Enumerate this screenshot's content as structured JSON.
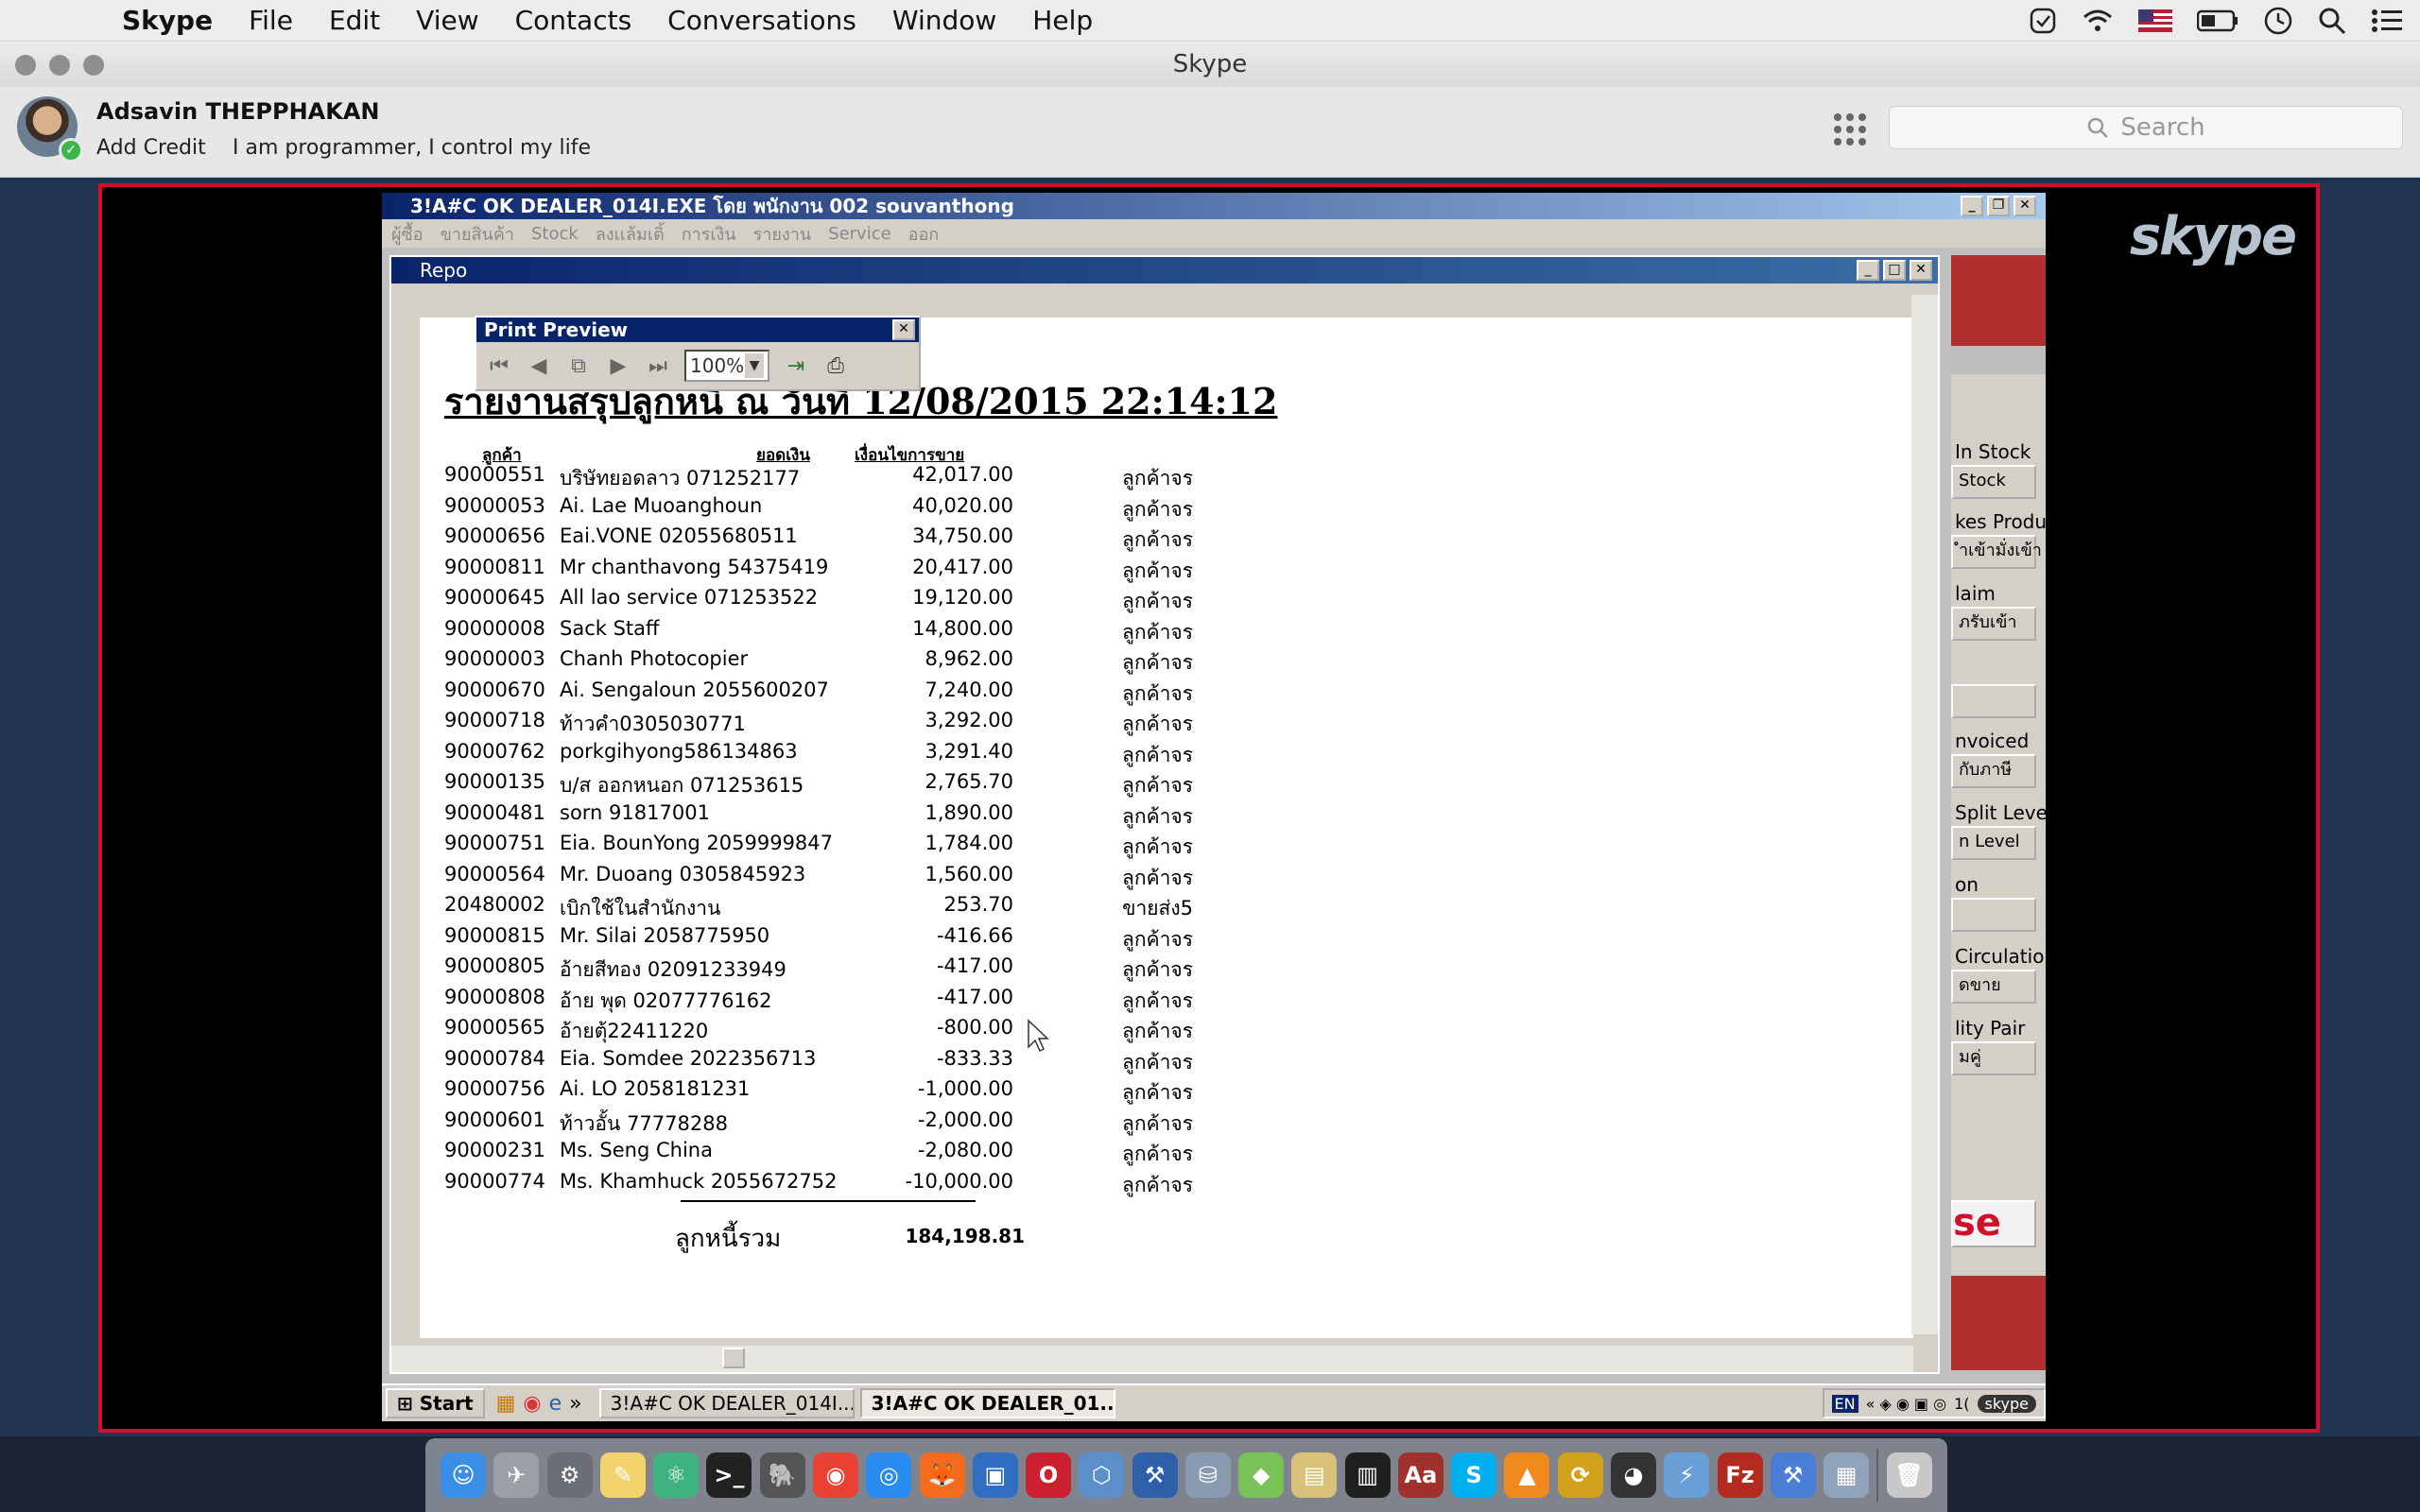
{
  "menubar": {
    "apple_glyph": "",
    "app_name": "Skype",
    "items": [
      "File",
      "Edit",
      "View",
      "Contacts",
      "Conversations",
      "Window",
      "Help"
    ]
  },
  "window": {
    "title": "Skype",
    "profile": {
      "name": "Adsavin THEPPHAKAN",
      "add_credit": "Add Credit",
      "mood": "I am programmer, I control my life"
    },
    "search_placeholder": "Search"
  },
  "remote": {
    "app_title": "3!A#C OK DEALER_014I.EXE โดย พนักงาน 002 souvanthong",
    "menu": [
      "ผู้ซื้อ",
      "ขายสินค้า",
      "Stock",
      "ลงเเล้มเติ้",
      "การเงิน",
      "รายงาน",
      "Service",
      "ออก"
    ],
    "report_window_title": "Repo",
    "print_preview": {
      "title": "Print Preview",
      "zoom": "100%"
    },
    "report": {
      "title": "รายงานสรุปลูกหนี้ ณ วันที่ 12/08/2015 22:14:12",
      "col_customer": "ลูกค้า",
      "col_amount": "ยอดเงิน",
      "col_condition": "เงื่อนไขการขาย",
      "rows": [
        {
          "code": "90000551",
          "name": "บริษัทยอดลาว 071252177",
          "amount": "42,017.00",
          "type": "ลูกค้าจร"
        },
        {
          "code": "90000053",
          "name": "Ai. Lae Muoanghoun",
          "amount": "40,020.00",
          "type": "ลูกค้าจร"
        },
        {
          "code": "90000656",
          "name": "Eai.VONE 02055680511",
          "amount": "34,750.00",
          "type": "ลูกค้าจร"
        },
        {
          "code": "90000811",
          "name": "Mr chanthavong 54375419",
          "amount": "20,417.00",
          "type": "ลูกค้าจร"
        },
        {
          "code": "90000645",
          "name": "All lao service 071253522",
          "amount": "19,120.00",
          "type": "ลูกค้าจร"
        },
        {
          "code": "90000008",
          "name": "Sack Staff",
          "amount": "14,800.00",
          "type": "ลูกค้าจร"
        },
        {
          "code": "90000003",
          "name": "Chanh Photocopier",
          "amount": "8,962.00",
          "type": "ลูกค้าจร"
        },
        {
          "code": "90000670",
          "name": "Ai. Sengaloun 2055600207",
          "amount": "7,240.00",
          "type": "ลูกค้าจร"
        },
        {
          "code": "90000718",
          "name": "ท้าวคำ0305030771",
          "amount": "3,292.00",
          "type": "ลูกค้าจร"
        },
        {
          "code": "90000762",
          "name": "porkgihyong586134863",
          "amount": "3,291.40",
          "type": "ลูกค้าจร"
        },
        {
          "code": "90000135",
          "name": "บ/ส ออกหนอก 071253615",
          "amount": "2,765.70",
          "type": "ลูกค้าจร"
        },
        {
          "code": "90000481",
          "name": "sorn 91817001",
          "amount": "1,890.00",
          "type": "ลูกค้าจร"
        },
        {
          "code": "90000751",
          "name": "Eia. BounYong 2059999847",
          "amount": "1,784.00",
          "type": "ลูกค้าจร"
        },
        {
          "code": "90000564",
          "name": "Mr. Duoang 0305845923",
          "amount": "1,560.00",
          "type": "ลูกค้าจร"
        },
        {
          "code": "20480002",
          "name": "เบิกใช้ในสำนักงาน",
          "amount": "253.70",
          "type": "ขายส่ง5"
        },
        {
          "code": "90000815",
          "name": "Mr. Silai 2058775950",
          "amount": "-416.66",
          "type": "ลูกค้าจร"
        },
        {
          "code": "90000805",
          "name": "อ้ายสีทอง 02091233949",
          "amount": "-417.00",
          "type": "ลูกค้าจร"
        },
        {
          "code": "90000808",
          "name": "อ้าย พุด 02077776162",
          "amount": "-417.00",
          "type": "ลูกค้าจร"
        },
        {
          "code": "90000565",
          "name": "อ้ายตุ้22411220",
          "amount": "-800.00",
          "type": "ลูกค้าจร"
        },
        {
          "code": "90000784",
          "name": "Eia. Somdee 2022356713",
          "amount": "-833.33",
          "type": "ลูกค้าจร"
        },
        {
          "code": "90000756",
          "name": "Ai. LO 2058181231",
          "amount": "-1,000.00",
          "type": "ลูกค้าจร"
        },
        {
          "code": "90000601",
          "name": "ท้าวอั้น 77778288",
          "amount": "-2,000.00",
          "type": "ลูกค้าจร"
        },
        {
          "code": "90000231",
          "name": "Ms. Seng China",
          "amount": "-2,080.00",
          "type": "ลูกค้าจร"
        },
        {
          "code": "90000774",
          "name": "Ms. Khamhuck 2055672752",
          "amount": "-10,000.00",
          "type": "ลูกค้าจร"
        }
      ],
      "total_label": "ลูกหนี้รวม",
      "total_value": "184,198.81"
    },
    "side_panel": {
      "in_stock": "In Stock",
      "stock_btn": "Stock",
      "kes_product": "kes Produc",
      "receive_btn": "ำเข้ามั่งเข้า",
      "claim": "laim",
      "receive2_btn": "ภรับเข้า",
      "invoiced": "nvoiced",
      "tax_btn": "กับภาษี",
      "split_level": "Split Level",
      "n_level_btn": "n Level",
      "on_label": "on",
      "circulation": "Circulation",
      "sales_btn": "ดขาย",
      "lity_pair": "lity Pair",
      "pair_btn": "มคู่",
      "close_btn": "se"
    },
    "taskbar": {
      "start": "Start",
      "task1": "3!A#C OK DEALER_014I...",
      "task2": "3!A#C OK DEALER_01...",
      "lang": "EN",
      "skype_tray": "skype",
      "clock_frag": "1("
    }
  },
  "skype_watermark": "skype",
  "dock_apps": [
    "Finder",
    "Launchpad",
    "System Preferences",
    "Notes",
    "Atom",
    "Terminal",
    "Sequel Pro",
    "Chrome",
    "Safari",
    "Firefox",
    "Remote Desktop",
    "Opera",
    "VirtualBox",
    "Xcode",
    "SQL",
    "Android Studio",
    "Folder",
    "Activity Monitor",
    "Dictionary",
    "Skype",
    "VLC",
    "Sync",
    "GitHub",
    "Wireless",
    "FileZilla",
    "Xcode 2",
    "Screen Share",
    "Trash"
  ],
  "colors": {
    "share_border": "#d0102a",
    "win_titlebar": "#0a246a",
    "online": "#3cb64a"
  }
}
